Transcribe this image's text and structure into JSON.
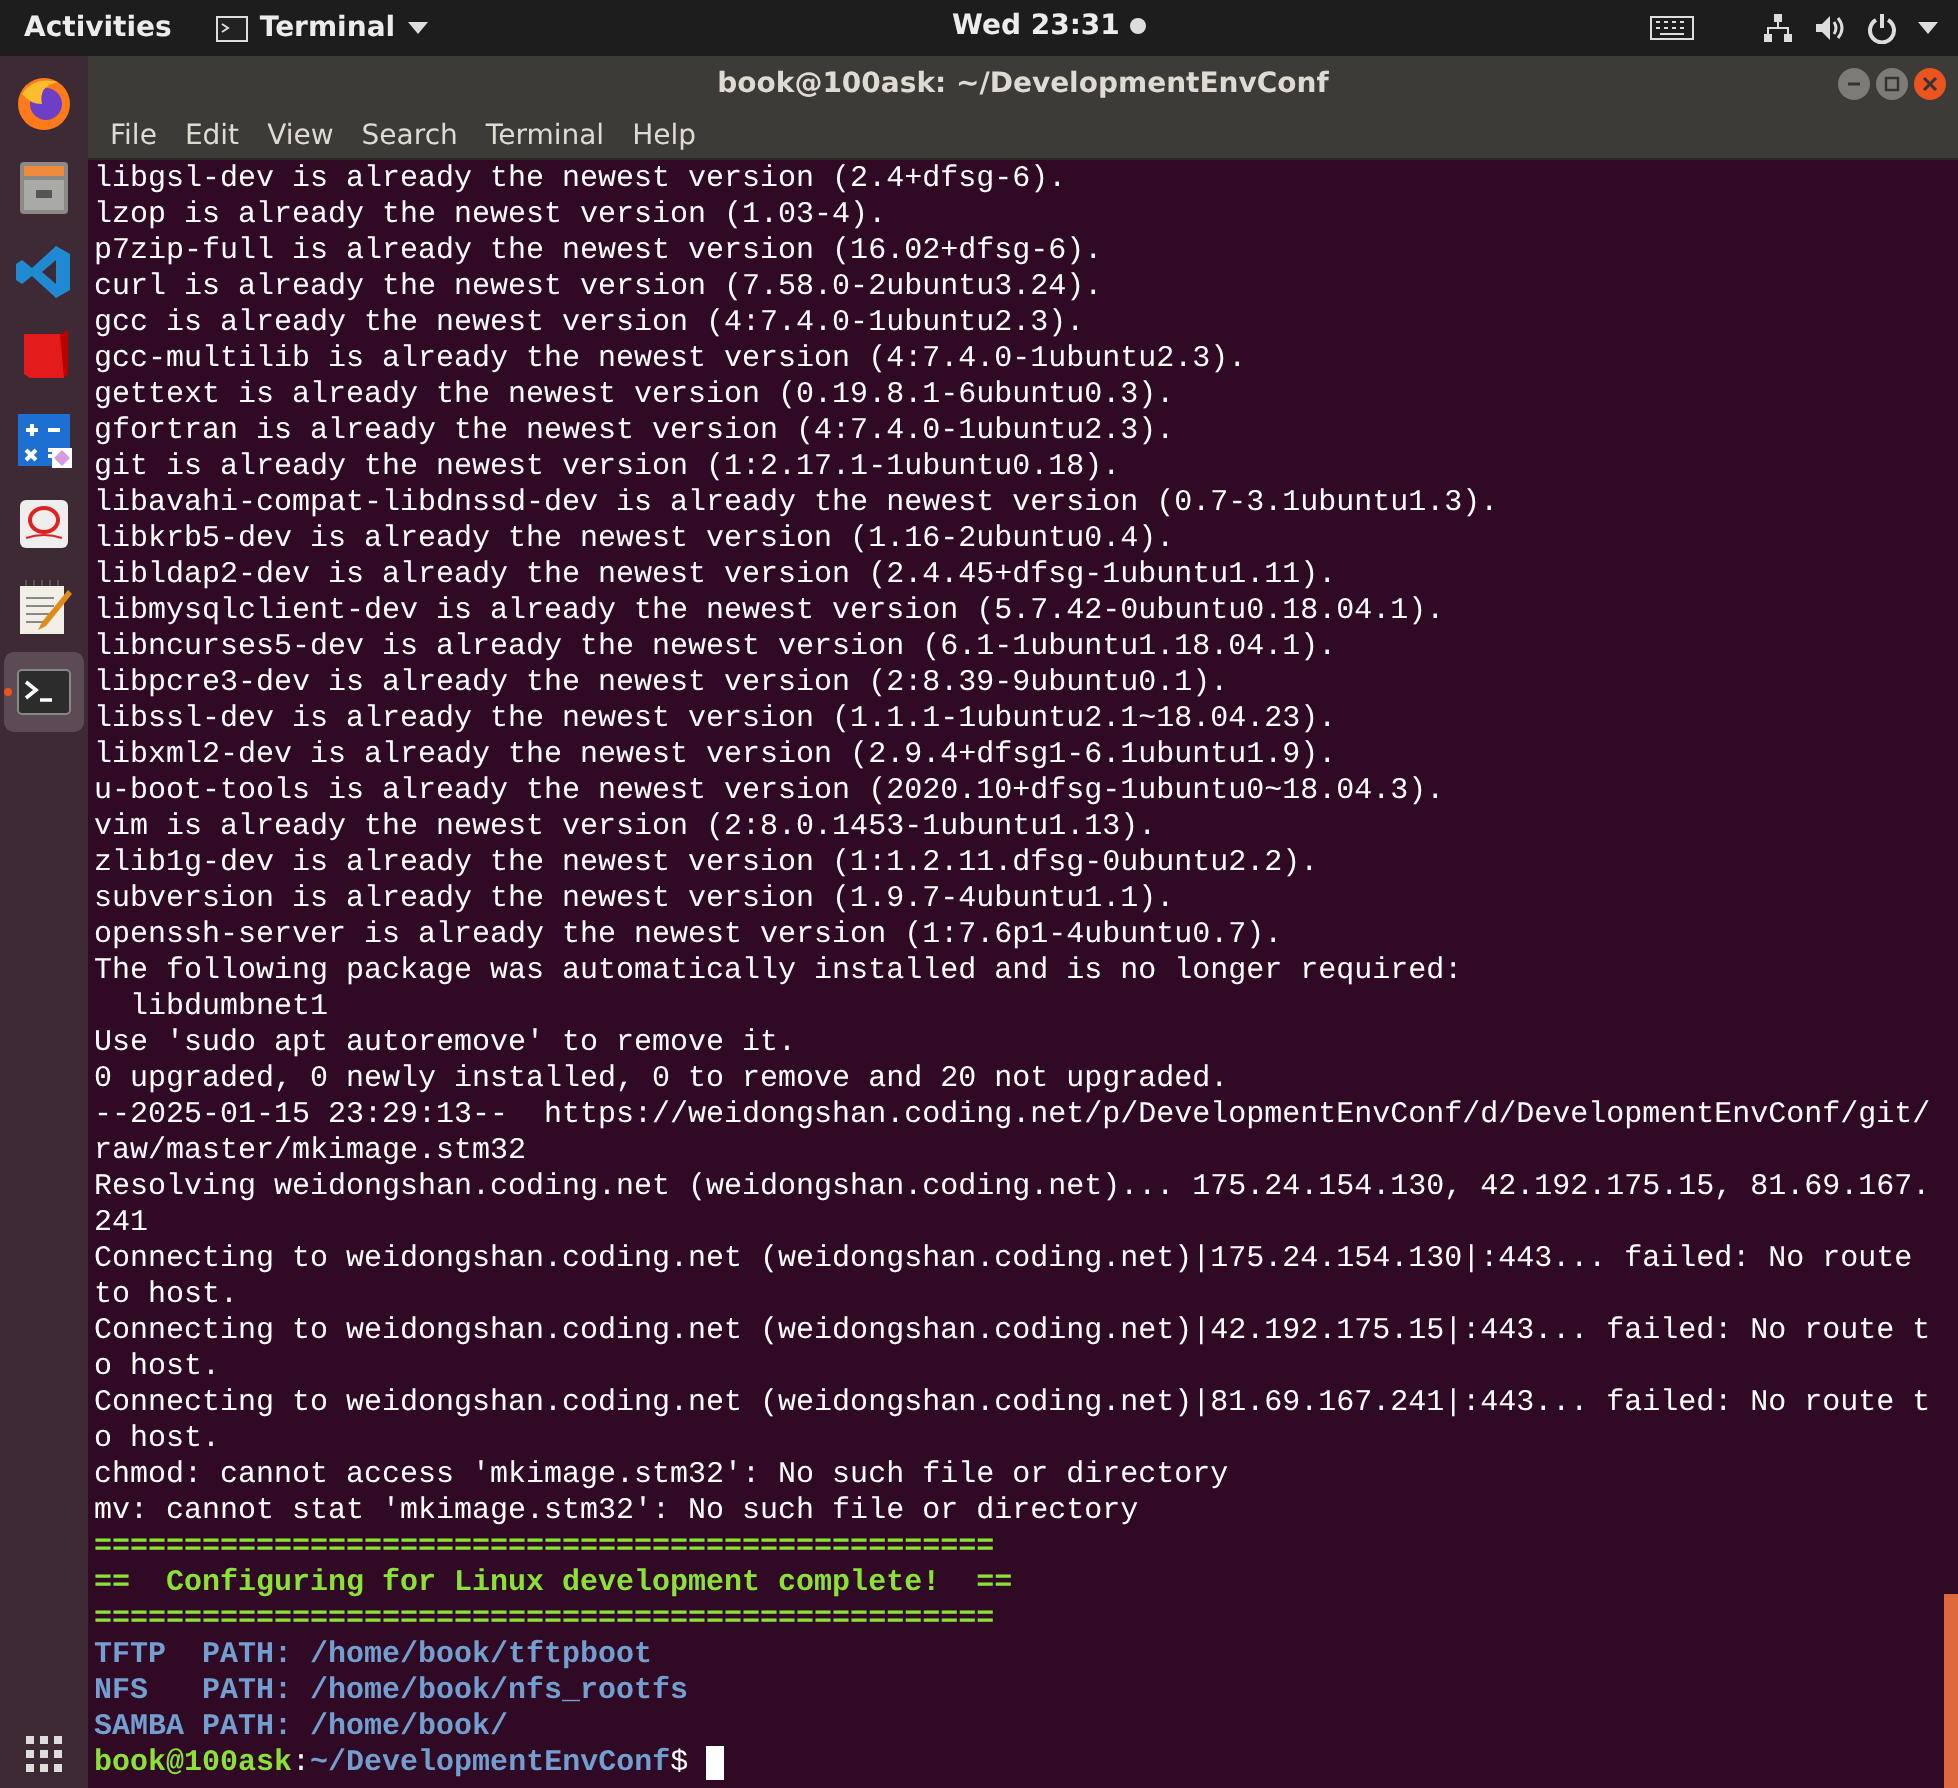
{
  "top_bar": {
    "activities": "Activities",
    "app_menu": "Terminal",
    "clock": "Wed 23:31"
  },
  "dock": {
    "items": [
      {
        "kind": "firefox",
        "selected": false
      },
      {
        "kind": "cabinet",
        "selected": false
      },
      {
        "kind": "code",
        "selected": false
      },
      {
        "kind": "red",
        "selected": false
      },
      {
        "kind": "calculator",
        "selected": false
      },
      {
        "kind": "reader",
        "selected": false
      },
      {
        "kind": "notepad",
        "selected": false
      },
      {
        "kind": "terminal",
        "selected": true
      }
    ]
  },
  "window": {
    "title": "book@100ask: ~/DevelopmentEnvConf",
    "menu": [
      "File",
      "Edit",
      "View",
      "Search",
      "Terminal",
      "Help"
    ]
  },
  "terminal": {
    "lines": [
      {
        "kind": "plain",
        "text": "libgsl-dev is already the newest version (2.4+dfsg-6)."
      },
      {
        "kind": "plain",
        "text": "lzop is already the newest version (1.03-4)."
      },
      {
        "kind": "plain",
        "text": "p7zip-full is already the newest version (16.02+dfsg-6)."
      },
      {
        "kind": "plain",
        "text": "curl is already the newest version (7.58.0-2ubuntu3.24)."
      },
      {
        "kind": "plain",
        "text": "gcc is already the newest version (4:7.4.0-1ubuntu2.3)."
      },
      {
        "kind": "plain",
        "text": "gcc-multilib is already the newest version (4:7.4.0-1ubuntu2.3)."
      },
      {
        "kind": "plain",
        "text": "gettext is already the newest version (0.19.8.1-6ubuntu0.3)."
      },
      {
        "kind": "plain",
        "text": "gfortran is already the newest version (4:7.4.0-1ubuntu2.3)."
      },
      {
        "kind": "plain",
        "text": "git is already the newest version (1:2.17.1-1ubuntu0.18)."
      },
      {
        "kind": "plain",
        "text": "libavahi-compat-libdnssd-dev is already the newest version (0.7-3.1ubuntu1.3)."
      },
      {
        "kind": "plain",
        "text": "libkrb5-dev is already the newest version (1.16-2ubuntu0.4)."
      },
      {
        "kind": "plain",
        "text": "libldap2-dev is already the newest version (2.4.45+dfsg-1ubuntu1.11)."
      },
      {
        "kind": "plain",
        "text": "libmysqlclient-dev is already the newest version (5.7.42-0ubuntu0.18.04.1)."
      },
      {
        "kind": "plain",
        "text": "libncurses5-dev is already the newest version (6.1-1ubuntu1.18.04.1)."
      },
      {
        "kind": "plain",
        "text": "libpcre3-dev is already the newest version (2:8.39-9ubuntu0.1)."
      },
      {
        "kind": "plain",
        "text": "libssl-dev is already the newest version (1.1.1-1ubuntu2.1~18.04.23)."
      },
      {
        "kind": "plain",
        "text": "libxml2-dev is already the newest version (2.9.4+dfsg1-6.1ubuntu1.9)."
      },
      {
        "kind": "plain",
        "text": "u-boot-tools is already the newest version (2020.10+dfsg-1ubuntu0~18.04.3)."
      },
      {
        "kind": "plain",
        "text": "vim is already the newest version (2:8.0.1453-1ubuntu1.13)."
      },
      {
        "kind": "plain",
        "text": "zlib1g-dev is already the newest version (1:1.2.11.dfsg-0ubuntu2.2)."
      },
      {
        "kind": "plain",
        "text": "subversion is already the newest version (1.9.7-4ubuntu1.1)."
      },
      {
        "kind": "plain",
        "text": "openssh-server is already the newest version (1:7.6p1-4ubuntu0.7)."
      },
      {
        "kind": "plain",
        "text": "The following package was automatically installed and is no longer required:"
      },
      {
        "kind": "plain",
        "text": "  libdumbnet1"
      },
      {
        "kind": "plain",
        "text": "Use 'sudo apt autoremove' to remove it."
      },
      {
        "kind": "plain",
        "text": "0 upgraded, 0 newly installed, 0 to remove and 20 not upgraded."
      },
      {
        "kind": "plain",
        "text": "--2025-01-15 23:29:13--  https://weidongshan.coding.net/p/DevelopmentEnvConf/d/DevelopmentEnvConf/git/"
      },
      {
        "kind": "plain",
        "text": "raw/master/mkimage.stm32"
      },
      {
        "kind": "plain",
        "text": "Resolving weidongshan.coding.net (weidongshan.coding.net)... 175.24.154.130, 42.192.175.15, 81.69.167."
      },
      {
        "kind": "plain",
        "text": "241"
      },
      {
        "kind": "plain",
        "text": "Connecting to weidongshan.coding.net (weidongshan.coding.net)|175.24.154.130|:443... failed: No route"
      },
      {
        "kind": "plain",
        "text": "to host."
      },
      {
        "kind": "plain",
        "text": "Connecting to weidongshan.coding.net (weidongshan.coding.net)|42.192.175.15|:443... failed: No route t"
      },
      {
        "kind": "plain",
        "text": "o host."
      },
      {
        "kind": "plain",
        "text": "Connecting to weidongshan.coding.net (weidongshan.coding.net)|81.69.167.241|:443... failed: No route t"
      },
      {
        "kind": "plain",
        "text": "o host."
      },
      {
        "kind": "plain",
        "text": "chmod: cannot access 'mkimage.stm32': No such file or directory"
      },
      {
        "kind": "plain",
        "text": "mv: cannot stat 'mkimage.stm32': No such file or directory"
      },
      {
        "kind": "banner",
        "text": "=================================================="
      },
      {
        "kind": "banner",
        "text": "==  Configuring for Linux development complete!  =="
      },
      {
        "kind": "banner",
        "text": "=================================================="
      },
      {
        "kind": "path",
        "text": "TFTP  PATH: /home/book/tftpboot"
      },
      {
        "kind": "path",
        "text": "NFS   PATH: /home/book/nfs_rootfs"
      },
      {
        "kind": "path",
        "text": "SAMBA PATH: /home/book/"
      }
    ],
    "prompt": {
      "user": "book@100ask",
      "separator": ":",
      "cwd": "~/DevelopmentEnvConf",
      "symbol": "$"
    }
  }
}
